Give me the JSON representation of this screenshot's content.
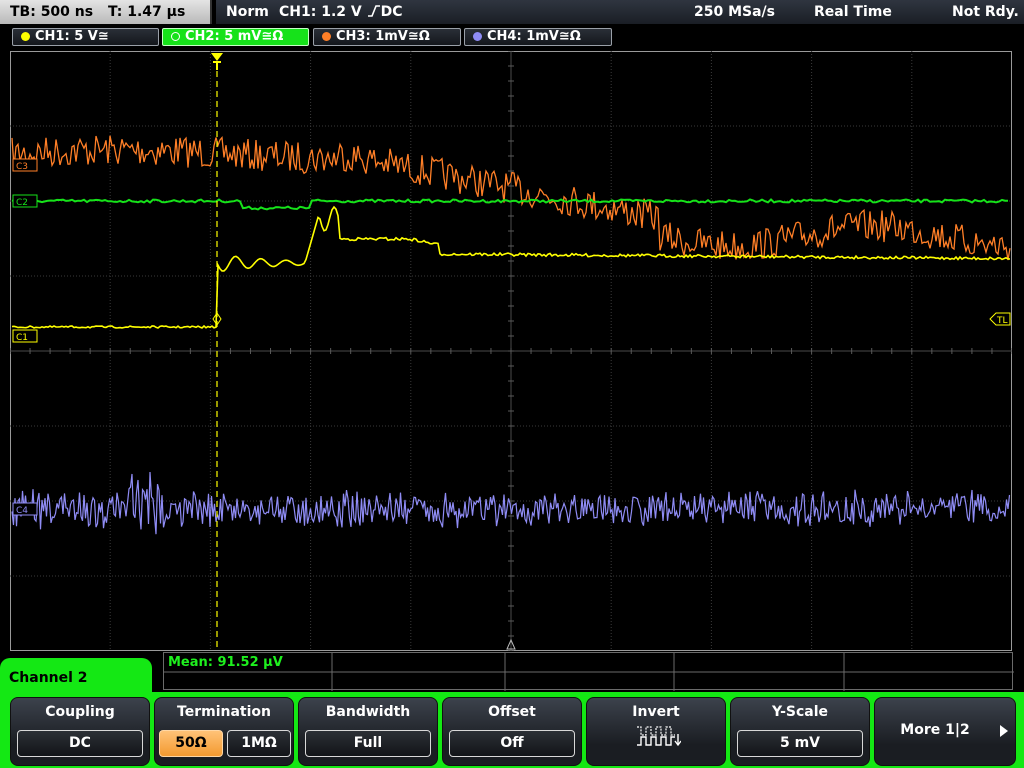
{
  "status": {
    "timebase": "TB: 500 ns",
    "trigger_time": "T: 1.47 µs",
    "trigger_mode": "Norm",
    "trigger_source": "CH1: 1.2 V",
    "trigger_slope_coupling": "DC",
    "sample_rate": "250 MSa/s",
    "acquisition_mode": "Real Time",
    "run_state": "Not Rdy."
  },
  "channels": [
    {
      "label": "CH1: 5 V",
      "coupling_symbol": "≅",
      "color": "#ffff00",
      "marker": "C1"
    },
    {
      "label": "CH2: 5 mV",
      "coupling_symbol": "≅Ω",
      "color": "#16e21a",
      "marker": "C2",
      "active": true
    },
    {
      "label": "CH3: 1mV",
      "coupling_symbol": "≅Ω",
      "color": "#ff7f27",
      "marker": "C3"
    },
    {
      "label": "CH4: 1mV",
      "coupling_symbol": "≅Ω",
      "color": "#8f8cf5",
      "marker": "C4"
    }
  ],
  "markers": {
    "trigger_level": "TL",
    "trigger_position": "T"
  },
  "measurement": {
    "mean": "Mean: 91.52 µV"
  },
  "menu": {
    "title": "Channel 2",
    "softkeys": {
      "coupling": {
        "title": "Coupling",
        "value": "DC"
      },
      "termination": {
        "title": "Termination",
        "options": [
          "50Ω",
          "1MΩ"
        ],
        "selected": "50Ω"
      },
      "bandwidth": {
        "title": "Bandwidth",
        "value": "Full"
      },
      "offset": {
        "title": "Offset",
        "value": "Off"
      },
      "invert": {
        "title": "Invert",
        "icon": "invert-pulse-icon"
      },
      "y_scale": {
        "title": "Y-Scale",
        "value": "5 mV"
      },
      "more": {
        "label": "More 1|2",
        "icon": "arrow-right-icon"
      }
    }
  },
  "colors": {
    "menu_accent": "#14e814",
    "grid": "#3a3a3a",
    "selected_option": "#f5a33c"
  }
}
